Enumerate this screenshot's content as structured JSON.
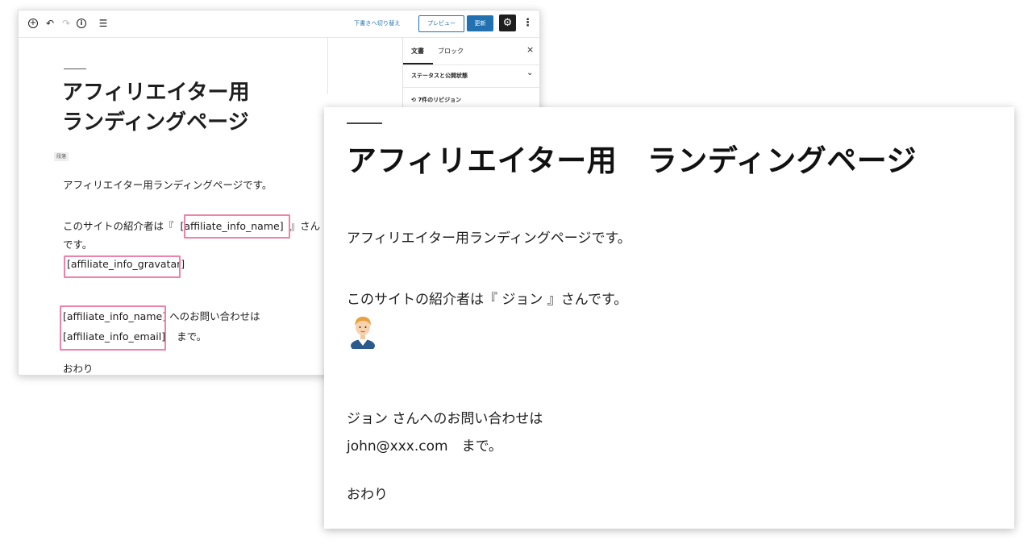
{
  "editor": {
    "toolbar": {
      "switch_to_draft": "下書きへ切り替え",
      "preview_button": "プレビュー",
      "update_button": "更新"
    },
    "title_line1": "アフィリエイター用",
    "title_line2": "ランディングページ",
    "block_tag": "段落",
    "paragraph1": "アフィリエイター用ランディングページです。",
    "intro_prefix": "このサイトの紹介者は『",
    "shortcode_name": "[affiliate_info_name]",
    "intro_suffix": "』さん",
    "intro_line2": "です。",
    "shortcode_gravatar": "[affiliate_info_gravatar]",
    "contact_suffix": "へのお問い合わせは",
    "shortcode_email": "[affiliate_info_email]",
    "contact_end": "まで。",
    "end_text": "おわり",
    "sidebar": {
      "tab_document": "文書",
      "tab_block": "ブロック",
      "close": "×",
      "status_label": "ステータスと公開状態",
      "revisions_label": "7件のリビジョン"
    }
  },
  "preview": {
    "title": "アフィリエイター用　ランディングページ",
    "paragraph1": "アフィリエイター用ランディングページです。",
    "intro": "このサイトの紹介者は『 ジョン 』さんです。",
    "contact_line1": "ジョン さんへのお問い合わせは",
    "contact_line2": "john@xxx.com　まで。",
    "end_text": "おわり"
  },
  "colors": {
    "accent": "#2271b1",
    "highlight": "#ee82a8"
  },
  "icons": [
    "add-block-icon",
    "undo-icon",
    "redo-icon",
    "info-icon",
    "list-view-icon",
    "gear-icon",
    "more-options-icon",
    "revisions-icon",
    "chevron-down-icon",
    "avatar-icon"
  ]
}
